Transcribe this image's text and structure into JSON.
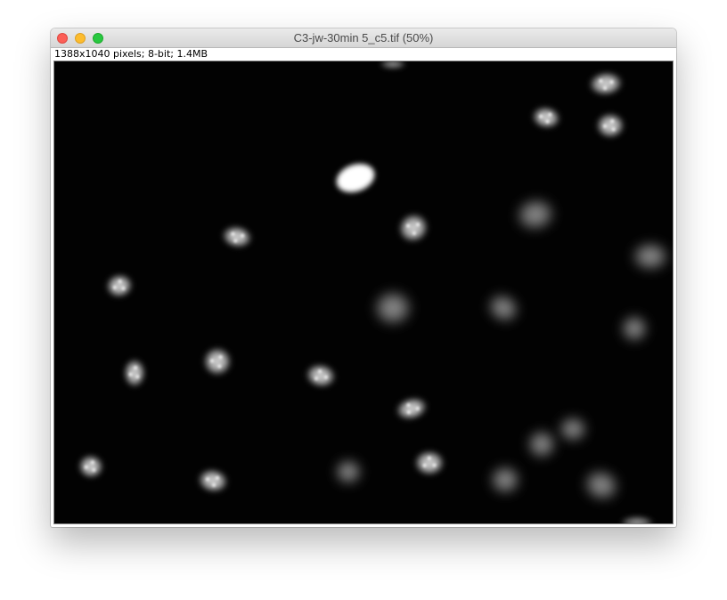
{
  "window": {
    "title": "C3-jw-30min 5_c5.tif (50%)",
    "info": "1388x1040 pixels; 8-bit; 1.4MB"
  },
  "colors": {
    "titlebar": "#dcdcdc",
    "image_background": "#020202",
    "close_button": "#fc5f57",
    "minimize_button": "#fdbc2e",
    "zoom_button": "#28c840"
  },
  "image": {
    "content": "grayscale fluorescence micrograph of cell nuclei"
  }
}
